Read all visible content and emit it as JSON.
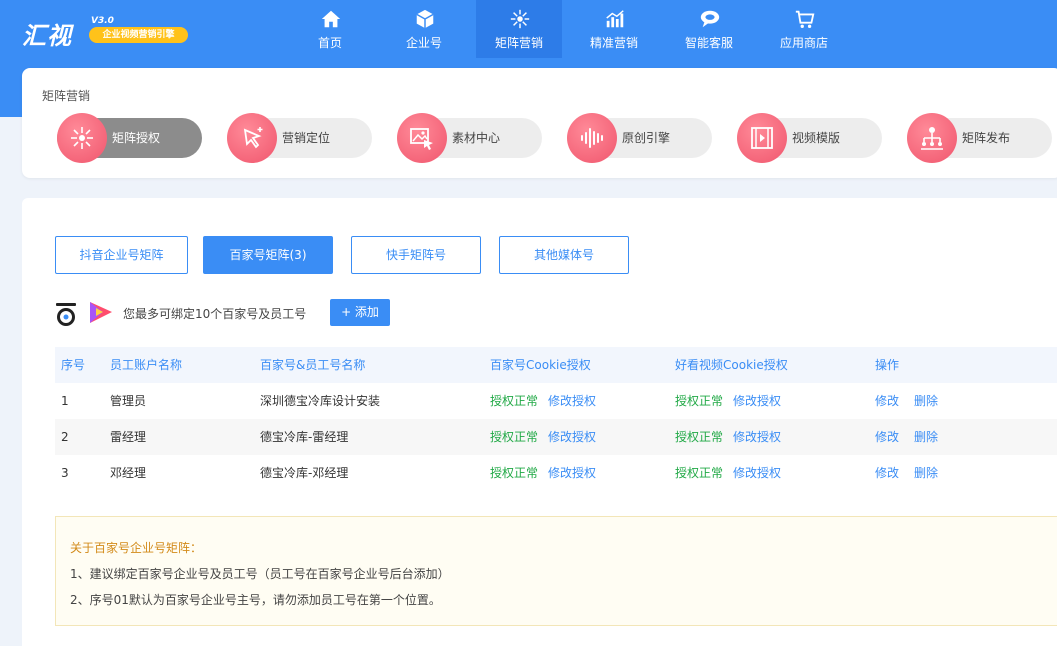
{
  "brand": {
    "name": "汇视",
    "version": "V3.0",
    "slogan": "企业视频营销引擎"
  },
  "nav": [
    {
      "label": "首页",
      "icon": "home-icon"
    },
    {
      "label": "企业号",
      "icon": "cube-icon"
    },
    {
      "label": "矩阵营销",
      "icon": "matrix-icon",
      "active": true
    },
    {
      "label": "精准营销",
      "icon": "bar-chart-icon"
    },
    {
      "label": "智能客服",
      "icon": "chat-bubble-icon"
    },
    {
      "label": "应用商店",
      "icon": "cart-icon"
    }
  ],
  "breadcrumb": "矩阵营销",
  "modules": [
    {
      "label": "矩阵授权",
      "icon": "network-icon",
      "active": true
    },
    {
      "label": "营销定位",
      "icon": "cursor-click-icon"
    },
    {
      "label": "素材中心",
      "icon": "image-gallery-icon"
    },
    {
      "label": "原创引擎",
      "icon": "sound-wave-icon"
    },
    {
      "label": "视频模版",
      "icon": "film-icon"
    },
    {
      "label": "矩阵发布",
      "icon": "org-tree-icon"
    }
  ],
  "tabs": [
    {
      "label": "抖音企业号矩阵"
    },
    {
      "label": "百家号矩阵(3)",
      "active": true
    },
    {
      "label": "快手矩阵号"
    },
    {
      "label": "其他媒体号"
    }
  ],
  "info": {
    "text": "您最多可绑定10个百家号及员工号",
    "add_label": "+ 添加"
  },
  "table": {
    "headers": [
      "序号",
      "员工账户名称",
      "百家号&员工号名称",
      "百家号Cookie授权",
      "好看视频Cookie授权",
      "操作"
    ],
    "rows": [
      {
        "no": "1",
        "account": "管理员",
        "name": "深圳德宝冷库设计安装",
        "bj_status": "授权正常",
        "bj_action": "修改授权",
        "hk_status": "授权正常",
        "hk_action": "修改授权",
        "edit": "修改",
        "del": "删除"
      },
      {
        "no": "2",
        "account": "雷经理",
        "name": "德宝冷库-雷经理",
        "bj_status": "授权正常",
        "bj_action": "修改授权",
        "hk_status": "授权正常",
        "hk_action": "修改授权",
        "edit": "修改",
        "del": "删除"
      },
      {
        "no": "3",
        "account": "邓经理",
        "name": "德宝冷库-邓经理",
        "bj_status": "授权正常",
        "bj_action": "修改授权",
        "hk_status": "授权正常",
        "hk_action": "修改授权",
        "edit": "修改",
        "del": "删除"
      }
    ]
  },
  "note": {
    "title": "关于百家号企业号矩阵：",
    "lines": [
      "1、建议绑定百家号企业号及员工号（员工号在百家号企业号后台添加）",
      "2、序号01默认为百家号企业号主号，请勿添加员工号在第一个位置。"
    ]
  },
  "colors": {
    "primary": "#3a8df5",
    "ok": "#21a946",
    "pill_icon": "#f0566d",
    "note_title": "#d38b1a"
  }
}
